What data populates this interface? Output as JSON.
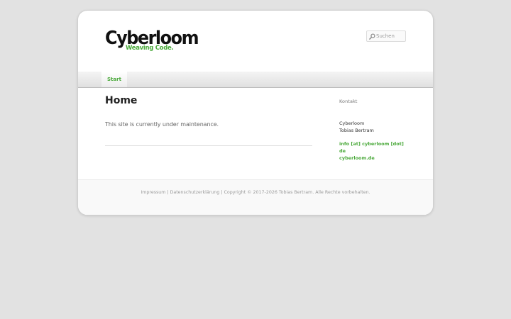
{
  "site": {
    "title": "Cyberloom",
    "tagline": "Weaving Code."
  },
  "search": {
    "placeholder": "Suchen",
    "icon": "search-icon"
  },
  "nav": {
    "items": [
      {
        "label": "Start"
      }
    ]
  },
  "main": {
    "title": "Home",
    "text": "This site is currently under maintenance."
  },
  "sidebar": {
    "widget_title": "Kontakt",
    "lines": [
      "Cyberloom",
      "Tobias Bertram"
    ],
    "email_lines": [
      "info [at] cyberloom [dot]",
      "de",
      "cyberloom.de"
    ]
  },
  "footer": {
    "impressum": "Impressum",
    "sep1": " | ",
    "datenschutz": "Datenschutzerklärung",
    "sep2": " | ",
    "copyright": "Copyright © 2017-2026 Tobias Bertram. Alle Rechte vorbehalten."
  },
  "colors": {
    "accent": "#4aa93a",
    "background": "#e2e2e2"
  }
}
